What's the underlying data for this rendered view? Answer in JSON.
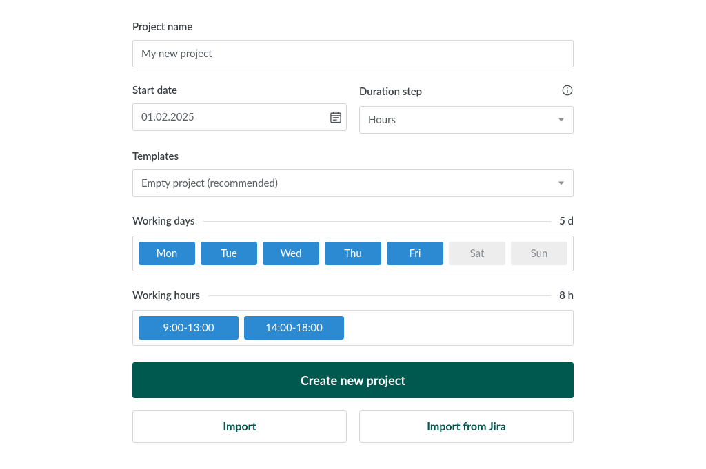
{
  "project_name": {
    "label": "Project name",
    "value": "My new project"
  },
  "start_date": {
    "label": "Start date",
    "value": "01.02.2025"
  },
  "duration_step": {
    "label": "Duration step",
    "value": "Hours"
  },
  "templates": {
    "label": "Templates",
    "value": "Empty project (recommended)"
  },
  "working_days": {
    "label": "Working days",
    "count": "5 d",
    "days": [
      {
        "label": "Mon",
        "selected": true
      },
      {
        "label": "Tue",
        "selected": true
      },
      {
        "label": "Wed",
        "selected": true
      },
      {
        "label": "Thu",
        "selected": true
      },
      {
        "label": "Fri",
        "selected": true
      },
      {
        "label": "Sat",
        "selected": false
      },
      {
        "label": "Sun",
        "selected": false
      }
    ]
  },
  "working_hours": {
    "label": "Working hours",
    "count": "8 h",
    "ranges": [
      "9:00-13:00",
      "14:00-18:00"
    ]
  },
  "buttons": {
    "create": "Create new project",
    "import": "Import",
    "import_jira": "Import from Jira"
  }
}
